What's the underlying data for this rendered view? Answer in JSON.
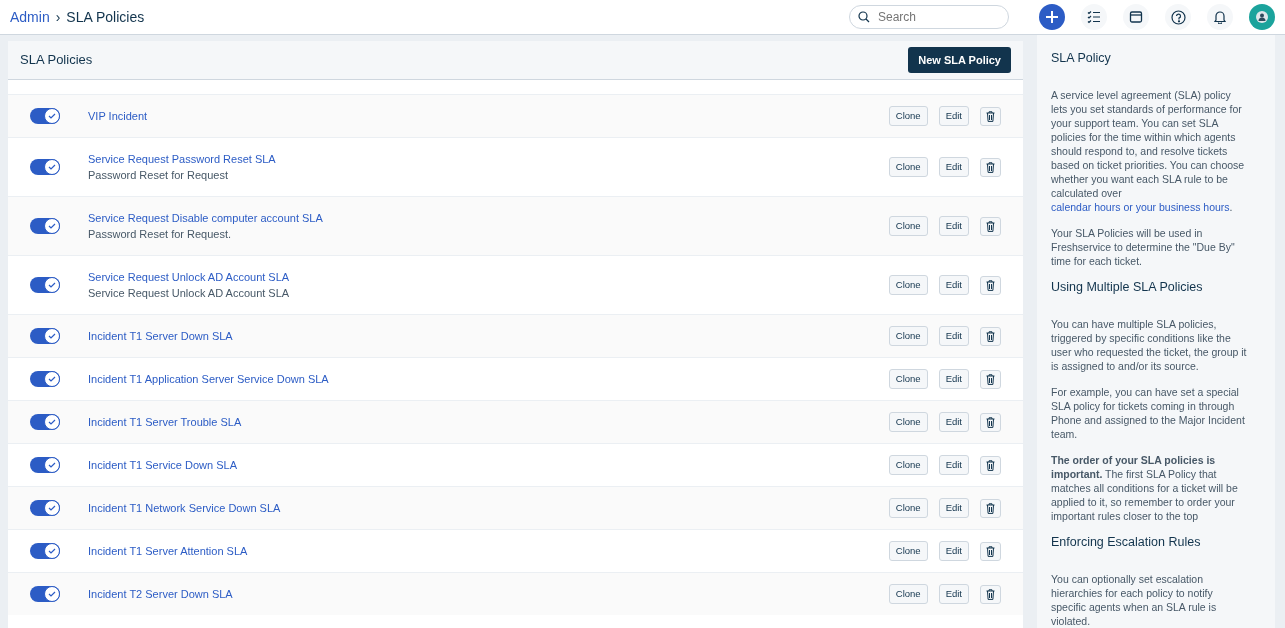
{
  "breadcrumb": {
    "parent": "Admin",
    "separator": "›",
    "current": "SLA Policies"
  },
  "search": {
    "placeholder": "Search"
  },
  "list": {
    "title": "SLA Policies",
    "new_button": "New SLA Policy",
    "rows": [
      {
        "name": "VIP Incident",
        "on": true,
        "clone_label": "Clone",
        "edit_label": "Edit"
      },
      {
        "name": "Service Request Password Reset SLA",
        "description": "Password Reset for Request",
        "on": true,
        "clone_label": "Clone",
        "edit_label": "Edit"
      },
      {
        "name": "Service Request Disable computer account SLA",
        "description": "Password Reset for Request.",
        "on": true,
        "clone_label": "Clone",
        "edit_label": "Edit"
      },
      {
        "name": "Service Request Unlock AD Account SLA",
        "description": "Service Request Unlock AD Account SLA",
        "on": true,
        "clone_label": "Clone",
        "edit_label": "Edit"
      },
      {
        "name": "Incident T1 Server Down SLA",
        "on": true,
        "clone_label": "Clone",
        "edit_label": "Edit"
      },
      {
        "name": "Incident T1 Application Server Service Down SLA",
        "on": true,
        "clone_label": "Clone",
        "edit_label": "Edit"
      },
      {
        "name": "Incident T1 Server Trouble SLA",
        "on": true,
        "clone_label": "Clone",
        "edit_label": "Edit"
      },
      {
        "name": "Incident T1 Service Down SLA",
        "on": true,
        "clone_label": "Clone",
        "edit_label": "Edit"
      },
      {
        "name": "Incident T1 Network Service Down SLA",
        "on": true,
        "clone_label": "Clone",
        "edit_label": "Edit"
      },
      {
        "name": "Incident T1 Server Attention SLA",
        "on": true,
        "clone_label": "Clone",
        "edit_label": "Edit"
      },
      {
        "name": "Incident T2 Server Down SLA",
        "on": true,
        "clone_label": "Clone",
        "edit_label": "Edit"
      }
    ]
  },
  "help": {
    "sections": [
      {
        "heading": "SLA Policy",
        "paragraphs": [
          {
            "text": "A service level agreement (SLA) policy lets you set standards of performance for your support team. You can set SLA policies for the time within which agents should respond to, and resolve tickets based on ticket priorities. You can choose whether you want each SLA rule to be calculated over ",
            "link": "calendar hours or your business hours",
            "after": "."
          },
          {
            "text": "Your SLA Policies will be used in Freshservice to determine the \"Due By\" time for each ticket."
          }
        ]
      },
      {
        "heading": "Using Multiple SLA Policies",
        "paragraphs": [
          {
            "text": "You can have multiple SLA policies, triggered by specific conditions like the user who requested the ticket, the group it is assigned to and/or its source."
          },
          {
            "text": "For example, you can have set a special SLA policy for tickets coming in through Phone and assigned to the Major Incident team."
          },
          {
            "text": "**The order of your SLA policies is important.** The first SLA Policy that matches all conditions for a ticket will be applied to it, so remember to order your important rules closer to the top"
          }
        ]
      },
      {
        "heading": "Enforcing Escalation Rules",
        "paragraphs": [
          {
            "text": "You can optionally set escalation hierarchies for each policy to notify specific agents when an SLA rule is violated."
          }
        ]
      }
    ]
  }
}
